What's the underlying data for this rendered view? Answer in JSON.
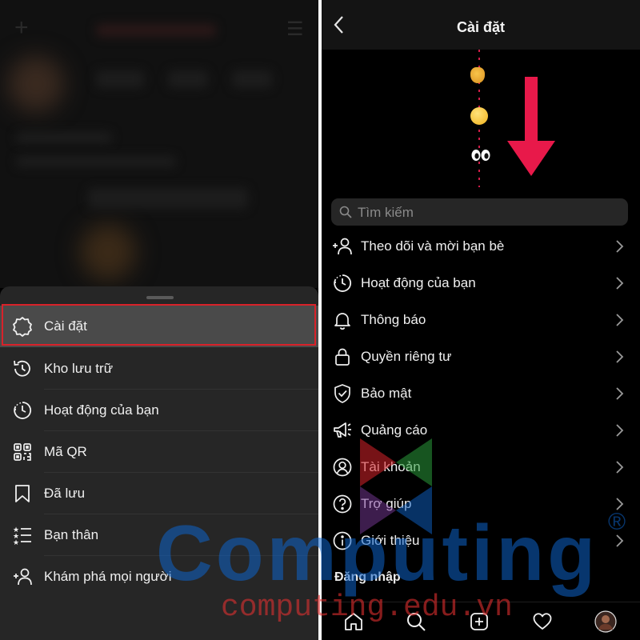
{
  "left": {
    "menu": [
      {
        "label": "Cài đặt",
        "icon": "gear-icon",
        "selected": true
      },
      {
        "label": "Kho lưu trữ",
        "icon": "archive-history-icon"
      },
      {
        "label": "Hoạt động của bạn",
        "icon": "activity-clock-icon"
      },
      {
        "label": "Mã QR",
        "icon": "qr-code-icon"
      },
      {
        "label": "Đã lưu",
        "icon": "bookmark-icon"
      },
      {
        "label": "Bạn thân",
        "icon": "close-friends-list-icon"
      },
      {
        "label": "Khám phá mọi người",
        "icon": "add-person-icon"
      }
    ]
  },
  "right": {
    "header": {
      "back_icon": "chevron-left-icon",
      "title": "Cài đặt"
    },
    "search": {
      "placeholder": "Tìm kiếm",
      "icon": "search-icon"
    },
    "settings": [
      {
        "label": "Theo dõi và mời bạn bè",
        "icon": "add-person-icon"
      },
      {
        "label": "Hoạt động của bạn",
        "icon": "activity-clock-icon"
      },
      {
        "label": "Thông báo",
        "icon": "bell-icon"
      },
      {
        "label": "Quyền riêng tư",
        "icon": "lock-icon"
      },
      {
        "label": "Bảo mật",
        "icon": "shield-check-icon"
      },
      {
        "label": "Quảng cáo",
        "icon": "megaphone-icon"
      },
      {
        "label": "Tài khoản",
        "icon": "account-circle-icon"
      },
      {
        "label": "Trợ giúp",
        "icon": "help-circle-icon"
      },
      {
        "label": "Giới thiệu",
        "icon": "info-icon"
      }
    ],
    "section_login": "Đăng nhập",
    "tabs": [
      "home-icon",
      "search-icon",
      "new-post-icon",
      "heart-icon",
      "profile-avatar"
    ]
  },
  "watermark": {
    "brand": "Computing",
    "registered": "®",
    "url": "computing.edu.vn"
  },
  "colors": {
    "background": "#000000",
    "sheet": "#262626",
    "highlight_border": "#d8222a",
    "annotation_arrow": "#e8194a",
    "watermark_blue": "#0e63c9",
    "watermark_red": "#e03030"
  }
}
